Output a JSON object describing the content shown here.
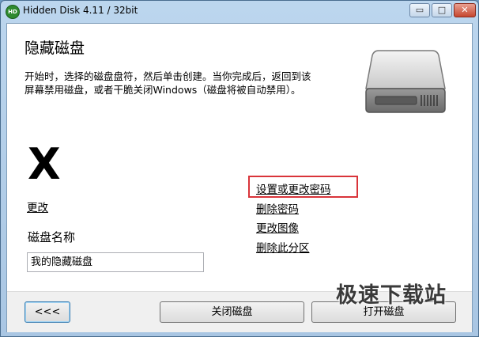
{
  "window": {
    "title": "Hidden Disk 4.11 / 32bit",
    "app_icon_text": "HD"
  },
  "titlebar": {
    "minimize": "▭",
    "maximize": "□",
    "close": "✕"
  },
  "main": {
    "heading": "隐藏磁盘",
    "description": "开始时，选择的磁盘盘符，然后单击创建。当你完成后，返回到该屏幕禁用磁盘，或者干脆关闭Windows（磁盘将被自动禁用）。",
    "drive_letter": "X",
    "change_link": "更改",
    "links": {
      "set_password": "设置或更改密码",
      "delete_password": "删除密码",
      "change_image": "更改图像",
      "delete_partition": "删除此分区"
    },
    "disk_name_label": "磁盘名称",
    "disk_name_value": "我的隐藏磁盘"
  },
  "footer": {
    "back_button": "<<<",
    "close_disk_button": "关闭磁盘",
    "open_disk_button": "打开磁盘"
  },
  "watermark": "极速下载站",
  "colors": {
    "highlight": "#d9343a",
    "title_bg": "#bcd6ee"
  },
  "icons": {
    "drive": "hard-drive-icon",
    "app": "app-icon"
  }
}
